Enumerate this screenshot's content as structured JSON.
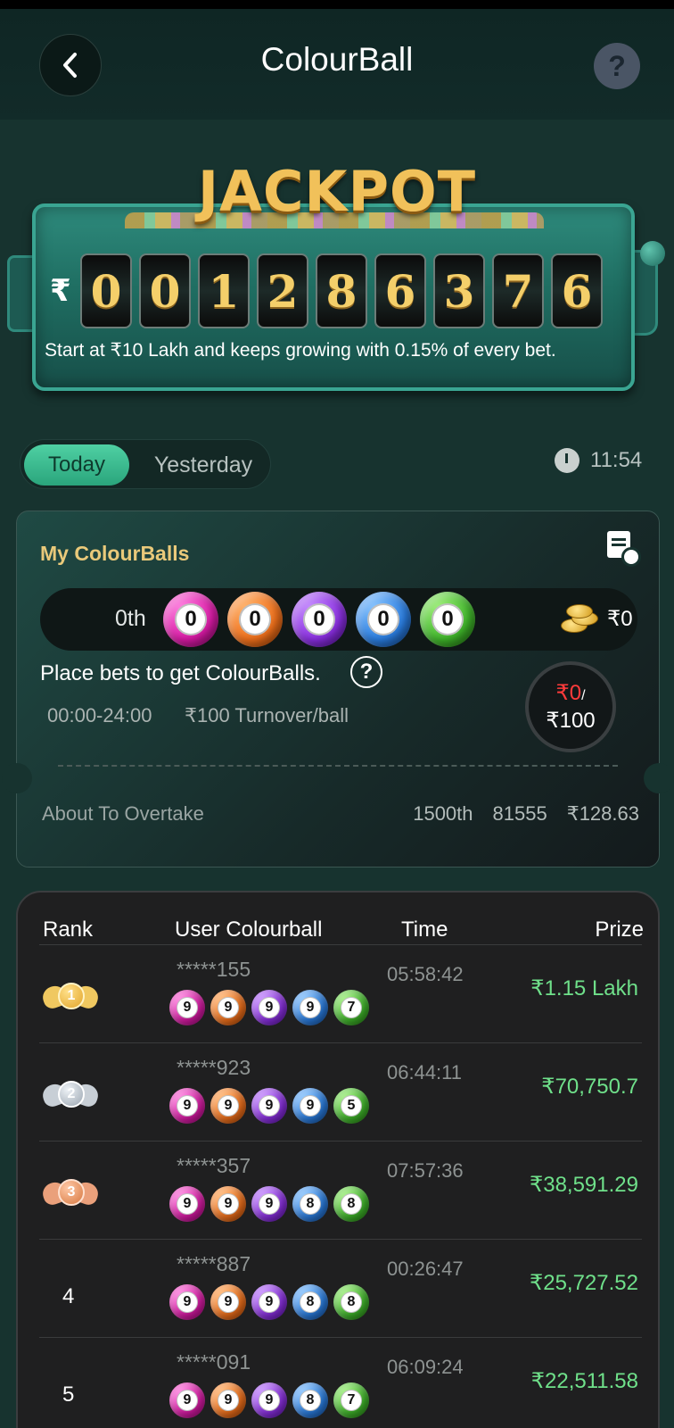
{
  "header": {
    "title": "ColourBall",
    "help_label": "?"
  },
  "jackpot": {
    "title": "JACKPOT",
    "currency": "₹",
    "digits": [
      "0",
      "0",
      "1",
      "2",
      "8",
      "6",
      "3",
      "7",
      "6"
    ],
    "description": "Start at ₹10 Lakh and keeps growing with 0.15% of every bet."
  },
  "tabs": {
    "today": "Today",
    "yesterday": "Yesterday"
  },
  "timer": {
    "value": "11:54"
  },
  "my_colourballs": {
    "title": "My ColourBalls",
    "rank": "0th",
    "balls": [
      {
        "number": "0",
        "color": "pink"
      },
      {
        "number": "0",
        "color": "orange"
      },
      {
        "number": "0",
        "color": "purple"
      },
      {
        "number": "0",
        "color": "blue"
      },
      {
        "number": "0",
        "color": "green"
      }
    ],
    "prize": "₹0",
    "place_bets": "Place bets to get ColourBalls.",
    "rule_time": "00:00-24:00",
    "rule_turnover": "₹100 Turnover/ball",
    "turnover_current": "₹0",
    "turnover_slash": "/",
    "turnover_target": "₹100",
    "overtake_label": "About To Overtake",
    "overtake_rank": "1500th",
    "overtake_user": "81555",
    "overtake_amount": "₹128.63"
  },
  "leaderboard": {
    "headers": {
      "rank": "Rank",
      "user": "User Colourball",
      "time": "Time",
      "prize": "Prize"
    },
    "rows": [
      {
        "rank": "1",
        "user": "*****155",
        "balls": [
          "9",
          "9",
          "9",
          "9",
          "7"
        ],
        "time": "05:58:42",
        "prize": "₹1.15 Lakh"
      },
      {
        "rank": "2",
        "user": "*****923",
        "balls": [
          "9",
          "9",
          "9",
          "9",
          "5"
        ],
        "time": "06:44:11",
        "prize": "₹70,750.7"
      },
      {
        "rank": "3",
        "user": "*****357",
        "balls": [
          "9",
          "9",
          "9",
          "8",
          "8"
        ],
        "time": "07:57:36",
        "prize": "₹38,591.29"
      },
      {
        "rank": "4",
        "user": "*****887",
        "balls": [
          "9",
          "9",
          "9",
          "8",
          "8"
        ],
        "time": "00:26:47",
        "prize": "₹25,727.52"
      },
      {
        "rank": "5",
        "user": "*****091",
        "balls": [
          "9",
          "9",
          "9",
          "8",
          "7"
        ],
        "time": "06:09:24",
        "prize": "₹22,511.58"
      }
    ]
  },
  "colors": {
    "background": "#17332f",
    "accent_green": "#4fd0a3",
    "gold_text": "#e9c97a",
    "prize_green": "#6fe08a",
    "turnover_red": "#ff3b3b"
  },
  "icons": [
    "chevron-left-icon",
    "help-icon",
    "timer-icon",
    "history-icon",
    "coins-icon",
    "question-icon",
    "gold-medal-icon",
    "silver-medal-icon",
    "bronze-medal-icon"
  ]
}
